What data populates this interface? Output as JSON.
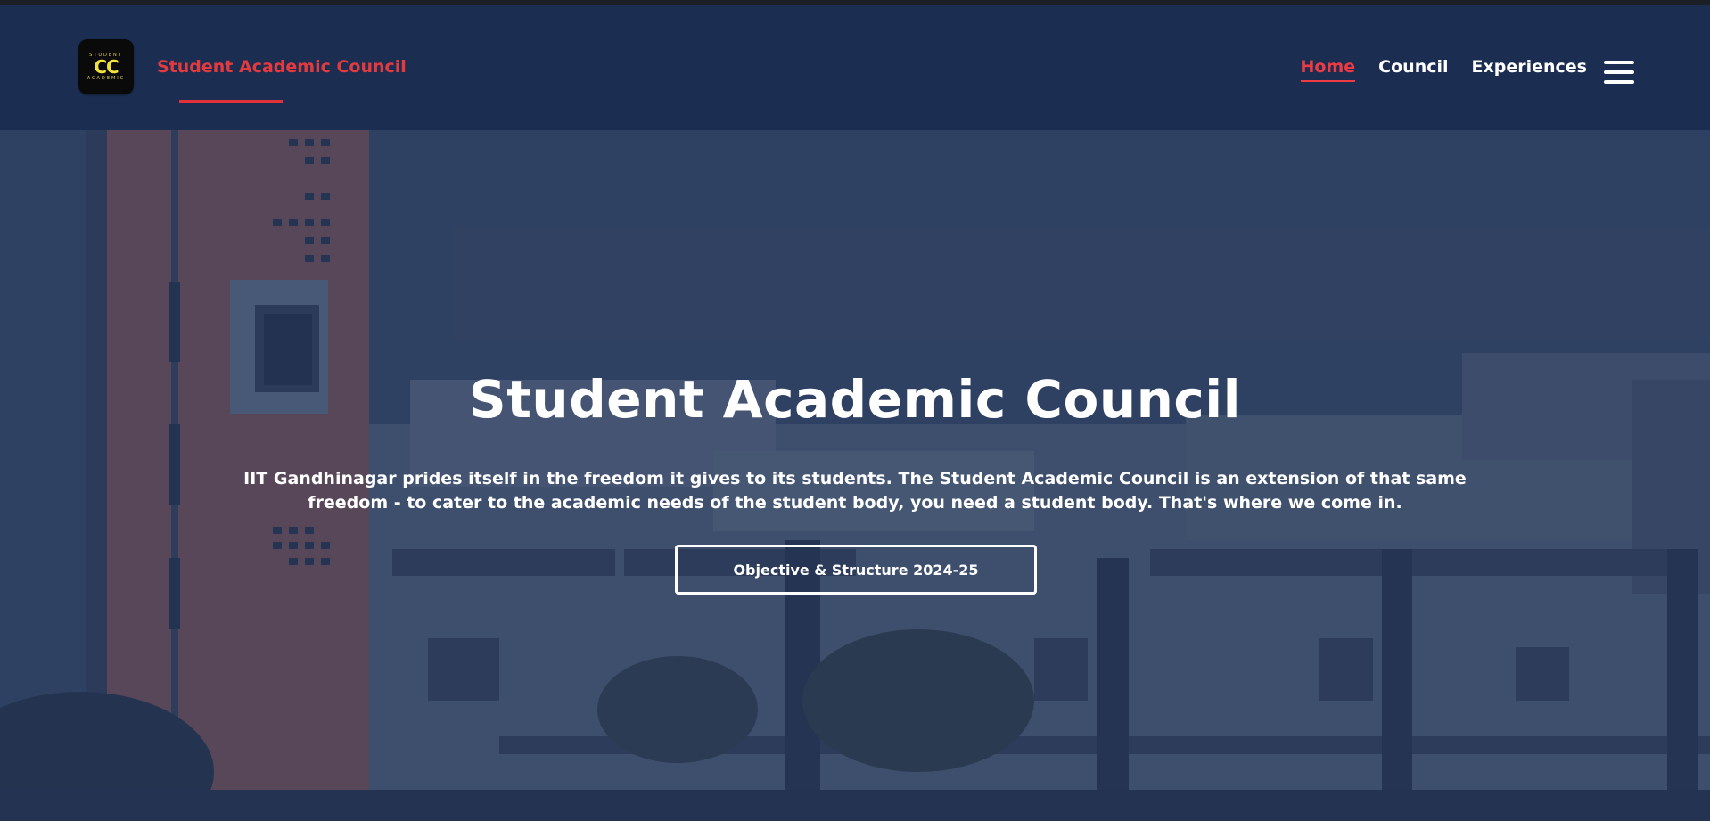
{
  "header": {
    "logo_mark": "CC",
    "logo_small_top": "STUDENT",
    "logo_small_bottom": "ACADEMIC",
    "brand_name": "Student Academic Council"
  },
  "nav": {
    "items": [
      {
        "label": "Home",
        "active": true
      },
      {
        "label": "Council",
        "active": false
      },
      {
        "label": "Experiences",
        "active": false
      }
    ],
    "menu_icon": "hamburger-menu-icon"
  },
  "hero": {
    "title": "Student Academic Council",
    "description": "IIT Gandhinagar prides itself in the freedom it gives to its students. The Student Academic Council is an extension of that same freedom - to cater to the academic needs of the student body, you need a student body. That's where we come in.",
    "button_label": "Objective & Structure 2024-25"
  },
  "colors": {
    "header_bg": "#1b2e52",
    "accent_red": "#e23a3f",
    "logo_yellow": "#f2e23a",
    "text_white": "#ffffff"
  }
}
